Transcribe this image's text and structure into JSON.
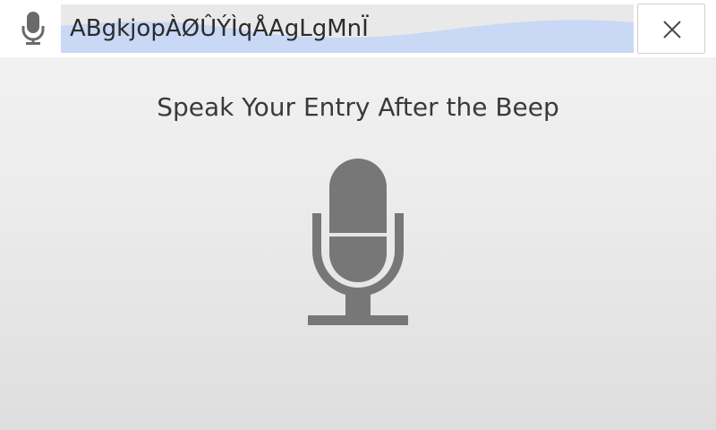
{
  "search_bar": {
    "mic_icon": "microphone-icon",
    "entry_text": "ABgkjopÀØÛÝÌqÅAgLgMnÏ",
    "close_icon": "close-icon"
  },
  "main": {
    "prompt": "Speak Your Entry After the Beep",
    "mic_icon": "microphone-icon"
  },
  "colors": {
    "icon_gray": "#757575",
    "wave_blue": "#c8d8f5",
    "entry_bg": "#e9e9e9"
  }
}
